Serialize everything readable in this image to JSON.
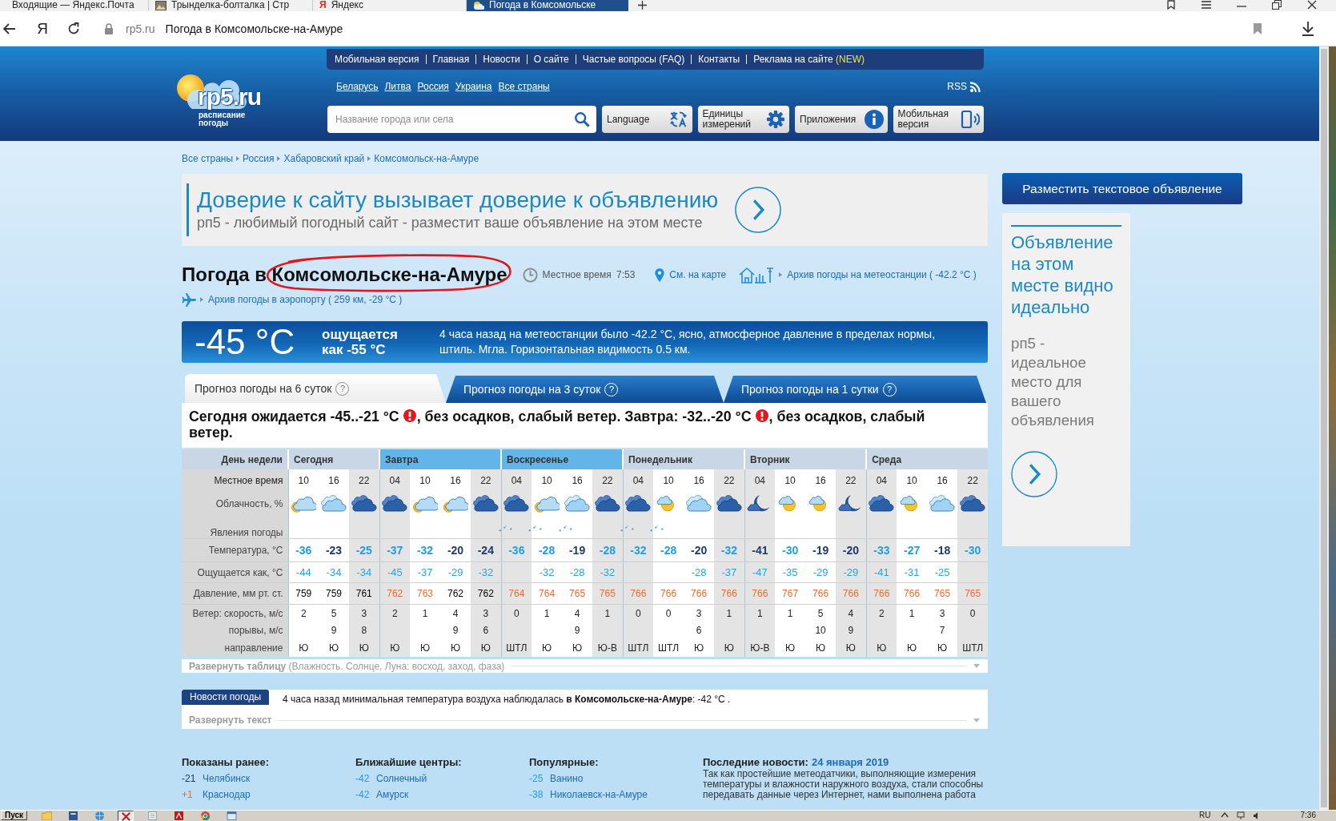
{
  "browser": {
    "tabs": [
      {
        "title": "Входящие — Яндекс.Почта",
        "selected": false
      },
      {
        "title": "Трынделка-болталка | Стр",
        "favicon": {
          "kind": "picture"
        },
        "selected": false
      },
      {
        "title": "Яндекс",
        "favicon": {
          "kind": "letter",
          "letter": "Я"
        },
        "selected": false
      },
      {
        "title": "Погода в Комсомольске",
        "favicon": {
          "kind": "weather"
        },
        "selected": true
      }
    ],
    "address": {
      "home": "Я",
      "domain": "rp5.ru",
      "title": "Погода в Комсомольске-на-Амуре"
    }
  },
  "header": {
    "logo": {
      "name": "rp5.ru",
      "tagline": "расписание погоды"
    },
    "nav": [
      {
        "label": "Мобильная версия"
      },
      {
        "label": "Главная"
      },
      {
        "label": "Новости"
      },
      {
        "label": "О сайте"
      },
      {
        "label": "Частые вопросы (FAQ)"
      },
      {
        "label": "Контакты"
      },
      {
        "label": "Реклама на сайте",
        "badge": "(NEW)"
      }
    ],
    "countries": [
      "Беларусь",
      "Литва",
      "Россия",
      "Украина",
      "Все страны"
    ],
    "rss": "RSS",
    "search": {
      "placeholder": "Название города или села"
    },
    "buttons": [
      {
        "kind": "language",
        "label": "Language"
      },
      {
        "kind": "units",
        "label": "Единицы измерений"
      },
      {
        "kind": "apps",
        "label": "Приложения"
      },
      {
        "kind": "mobile",
        "label": "Мобильная версия"
      }
    ]
  },
  "breadcrumbs": [
    "Все страны",
    "Россия",
    "Хабаровский край",
    "Комсомольск-на-Амуре"
  ],
  "ad_banner": {
    "title": "Доверие к сайту вызывает доверие к объявлению",
    "text": "рп5 - любимый погодный сайт - разместит ваше объявление на этом месте"
  },
  "location": {
    "title": "Погода в Комсомольске-на-Амуре",
    "local_time": {
      "label": "Местное время",
      "value": "7:53"
    },
    "links": [
      {
        "kind": "map",
        "label": "См. на карте"
      },
      {
        "kind": "station",
        "label": "Архив погоды на метеостанции ( -42.2 °C )"
      }
    ],
    "airport": {
      "label": "Архив погоды в аэропорту ( 259 км, -29 °C )"
    }
  },
  "current": {
    "temperature": "-45 °C",
    "feels_like": "ощущается как -55 °C",
    "description": "4 часа назад на метеостанции было -42.2 °C, ясно, атмосферное давление в пределах нормы, штиль. Мгла. Горизонтальная видимость 0.5 км."
  },
  "forecast_tabs": [
    {
      "label": "Прогноз погоды на 6 суток",
      "help": "?",
      "selected": true
    },
    {
      "label": "Прогноз погоды на 3 суток",
      "help": "?",
      "selected": false
    },
    {
      "label": "Прогноз погоды на 1 сутки",
      "help": "?",
      "selected": false
    }
  ],
  "summary": [
    {
      "text": "Сегодня ожидается -45..-21 °C",
      "warning": true
    },
    {
      "text": ", без осадков, слабый ветер. Завтра: -32..-20 °C",
      "warning": true
    },
    {
      "text": ", без осадков, слабый",
      "warning": false
    },
    {
      "text": "ветер.",
      "warning": false
    }
  ],
  "table": {
    "rows": [
      {
        "kind": "day",
        "label": "День недели"
      },
      {
        "kind": "time",
        "label": "Местное время"
      },
      {
        "kind": "cloud",
        "label": "Облачность, %"
      },
      {
        "kind": "phenomenon",
        "label": "Явления погоды"
      },
      {
        "kind": "temperature",
        "label": "Температура, °C"
      },
      {
        "kind": "feels_like",
        "label": "Ощущается как, °C"
      },
      {
        "kind": "pressure",
        "label": "Давление, мм рт. ст."
      },
      {
        "kind": "wind",
        "label": "Ветер: скорость, м/с"
      },
      {
        "kind": "gusts",
        "label": "порывы, м/с"
      },
      {
        "kind": "direction",
        "label": "направление"
      }
    ],
    "days": [
      {
        "name": "Сегодня",
        "weekend": false,
        "periods": [
          {
            "time": "10",
            "night": false,
            "cloud": {
              "kind": "cloudy_sun"
            },
            "temperature": {
              "value": "-36",
              "color": "#1e9de3"
            },
            "feels_like": "-44",
            "pressure": {
              "value": "759",
              "color": "#000000"
            },
            "wind": "2",
            "direction": "Ю"
          },
          {
            "time": "16",
            "night": false,
            "cloud": {
              "kind": "cloudy"
            },
            "temperature": {
              "value": "-23",
              "color": "#1c3b6c"
            },
            "feels_like": "-34",
            "pressure": {
              "value": "759",
              "color": "#000000"
            },
            "wind": "5",
            "gusts": "9",
            "direction": "Ю"
          },
          {
            "time": "22",
            "night": true,
            "cloud": {
              "kind": "night_cloudy"
            },
            "temperature": {
              "value": "-25",
              "color": "#1e9de3"
            },
            "feels_like": "-34",
            "pressure": {
              "value": "761",
              "color": "#000000"
            },
            "wind": "3",
            "gusts": "8",
            "direction": "Ю"
          }
        ]
      },
      {
        "name": "Завтра",
        "weekend": true,
        "periods": [
          {
            "time": "04",
            "night": true,
            "cloud": {
              "kind": "night_cloudy"
            },
            "temperature": {
              "value": "-37",
              "color": "#1e9de3"
            },
            "feels_like": "-45",
            "pressure": {
              "value": "762",
              "color": "#f0692d"
            },
            "wind": "2",
            "direction": "Ю"
          },
          {
            "time": "10",
            "night": false,
            "cloud": {
              "kind": "cloudy_sun"
            },
            "temperature": {
              "value": "-32",
              "color": "#1e9de3"
            },
            "feels_like": "-37",
            "pressure": {
              "value": "763",
              "color": "#f0692d"
            },
            "wind": "1",
            "direction": "Ю"
          },
          {
            "time": "16",
            "night": false,
            "cloud": {
              "kind": "cloudy_sun"
            },
            "temperature": {
              "value": "-20",
              "color": "#1c3b6c"
            },
            "feels_like": "-29",
            "pressure": {
              "value": "762",
              "color": "#000000"
            },
            "wind": "4",
            "gusts": "9",
            "direction": "Ю"
          },
          {
            "time": "22",
            "night": true,
            "cloud": {
              "kind": "night_cloudy"
            },
            "temperature": {
              "value": "-24",
              "color": "#1c3b6c"
            },
            "feels_like": "-32",
            "pressure": {
              "value": "762",
              "color": "#000000"
            },
            "wind": "3",
            "gusts": "6",
            "direction": "Ю"
          }
        ]
      },
      {
        "name": "Воскресенье",
        "weekend": true,
        "periods": [
          {
            "time": "04",
            "night": true,
            "cloud": {
              "kind": "night_cloudy"
            },
            "phenomenon": {
              "kind": "light_snow"
            },
            "temperature": {
              "value": "-36",
              "color": "#1e9de3"
            },
            "pressure": {
              "value": "764",
              "color": "#f0692d"
            },
            "wind": "0",
            "direction": "ШТЛ"
          },
          {
            "time": "10",
            "night": false,
            "cloud": {
              "kind": "cloudy_sun"
            },
            "phenomenon": {
              "kind": "light_snow"
            },
            "temperature": {
              "value": "-28",
              "color": "#1e9de3"
            },
            "feels_like": "-32",
            "pressure": {
              "value": "764",
              "color": "#f0692d"
            },
            "wind": "1",
            "direction": "Ю"
          },
          {
            "time": "16",
            "night": false,
            "cloud": {
              "kind": "cloudy"
            },
            "phenomenon": {
              "kind": "light_snow"
            },
            "temperature": {
              "value": "-19",
              "color": "#1c3b6c"
            },
            "feels_like": "-28",
            "pressure": {
              "value": "765",
              "color": "#f0692d"
            },
            "wind": "4",
            "gusts": "9",
            "direction": "Ю"
          },
          {
            "time": "22",
            "night": true,
            "cloud": {
              "kind": "night_cloudy"
            },
            "temperature": {
              "value": "-28",
              "color": "#1e9de3"
            },
            "feels_like": "-32",
            "pressure": {
              "value": "765",
              "color": "#f0692d"
            },
            "wind": "1",
            "direction": "Ю-В"
          }
        ]
      },
      {
        "name": "Понедельник",
        "weekend": false,
        "periods": [
          {
            "time": "04",
            "night": true,
            "cloud": {
              "kind": "night_cloudy"
            },
            "phenomenon": {
              "kind": "light_snow"
            },
            "temperature": {
              "value": "-32",
              "color": "#1e9de3"
            },
            "pressure": {
              "value": "766",
              "color": "#f0692d"
            },
            "wind": "0",
            "direction": "ШТЛ"
          },
          {
            "time": "10",
            "night": false,
            "cloud": {
              "kind": "sunny_cloud"
            },
            "phenomenon": {
              "kind": "light_snow"
            },
            "temperature": {
              "value": "-28",
              "color": "#1e9de3"
            },
            "pressure": {
              "value": "766",
              "color": "#f0692d"
            },
            "wind": "0",
            "direction": "ШТЛ"
          },
          {
            "time": "16",
            "night": false,
            "cloud": {
              "kind": "cloudy"
            },
            "temperature": {
              "value": "-20",
              "color": "#1c3b6c"
            },
            "feels_like": "-28",
            "pressure": {
              "value": "766",
              "color": "#f0692d"
            },
            "wind": "3",
            "gusts": "6",
            "direction": "Ю"
          },
          {
            "time": "22",
            "night": true,
            "cloud": {
              "kind": "night_cloudy"
            },
            "temperature": {
              "value": "-32",
              "color": "#1e9de3"
            },
            "feels_like": "-37",
            "pressure": {
              "value": "766",
              "color": "#f0692d"
            },
            "wind": "1",
            "direction": "Ю"
          }
        ]
      },
      {
        "name": "Вторник",
        "weekend": false,
        "periods": [
          {
            "time": "04",
            "night": true,
            "cloud": {
              "kind": "night_moon"
            },
            "temperature": {
              "value": "-41",
              "color": "#1c3b6c"
            },
            "feels_like": "-47",
            "pressure": {
              "value": "766",
              "color": "#f0692d"
            },
            "wind": "1",
            "direction": "Ю-В"
          },
          {
            "time": "10",
            "night": false,
            "cloud": {
              "kind": "sunny_cloud"
            },
            "temperature": {
              "value": "-30",
              "color": "#1e9de3"
            },
            "feels_like": "-35",
            "pressure": {
              "value": "767",
              "color": "#f0692d"
            },
            "wind": "1",
            "direction": "Ю"
          },
          {
            "time": "16",
            "night": false,
            "cloud": {
              "kind": "sunny_cloud"
            },
            "temperature": {
              "value": "-19",
              "color": "#1c3b6c"
            },
            "feels_like": "-29",
            "pressure": {
              "value": "766",
              "color": "#f0692d"
            },
            "wind": "5",
            "gusts": "10",
            "direction": "Ю"
          },
          {
            "time": "22",
            "night": true,
            "cloud": {
              "kind": "night_moon"
            },
            "temperature": {
              "value": "-20",
              "color": "#1c3b6c"
            },
            "feels_like": "-29",
            "pressure": {
              "value": "766",
              "color": "#f0692d"
            },
            "wind": "4",
            "gusts": "9",
            "direction": "Ю"
          }
        ]
      },
      {
        "name": "Среда",
        "weekend": false,
        "periods": [
          {
            "time": "04",
            "night": true,
            "cloud": {
              "kind": "night_cloudy"
            },
            "temperature": {
              "value": "-33",
              "color": "#1e9de3"
            },
            "feels_like": "-41",
            "pressure": {
              "value": "766",
              "color": "#f0692d"
            },
            "wind": "2",
            "direction": "Ю"
          },
          {
            "time": "10",
            "night": false,
            "cloud": {
              "kind": "sunny_cloud"
            },
            "temperature": {
              "value": "-27",
              "color": "#1e9de3"
            },
            "feels_like": "-31",
            "pressure": {
              "value": "766",
              "color": "#f0692d"
            },
            "wind": "1",
            "direction": "Ю"
          },
          {
            "time": "16",
            "night": false,
            "cloud": {
              "kind": "cloudy"
            },
            "temperature": {
              "value": "-18",
              "color": "#1c3b6c"
            },
            "feels_like": "-25",
            "pressure": {
              "value": "765",
              "color": "#f0692d"
            },
            "wind": "3",
            "gusts": "7",
            "direction": "Ю"
          },
          {
            "time": "22",
            "night": true,
            "cloud": {
              "kind": "night_cloudy"
            },
            "temperature": {
              "value": "-30",
              "color": "#1e9de3"
            },
            "pressure": {
              "value": "765",
              "color": "#f0692d"
            },
            "wind": "0",
            "direction": "ШТЛ"
          }
        ]
      }
    ]
  },
  "expand_table": {
    "label": "Развернуть таблицу",
    "hint": "(Влажность. Солнце, Луна: восход, заход, фаза)"
  },
  "news": {
    "label": "Новости погоды",
    "text": "4 часа назад минимальная температура воздуха наблюдалась **в Комсомольске-на-Амуре**: -42 °C .",
    "expand": "Развернуть текст"
  },
  "footer": {
    "lists": [
      {
        "title": "Показаны ранее:",
        "items": [
          {
            "temperature": "-21",
            "color": "#1c3b6c",
            "name": "Челябинск"
          },
          {
            "temperature": "+1",
            "color": "#f0692d",
            "name": "Краснодар"
          }
        ]
      },
      {
        "title": "Ближайшие центры:",
        "items": [
          {
            "temperature": "-42",
            "color": "#1e9de3",
            "name": "Солнечный"
          },
          {
            "temperature": "-42",
            "color": "#1e9de3",
            "name": "Амурск"
          }
        ]
      },
      {
        "title": "Популярные:",
        "items": [
          {
            "temperature": "-25",
            "color": "#1e9de3",
            "name": "Ванино"
          },
          {
            "temperature": "-38",
            "color": "#1e9de3",
            "name": "Николаевск-на-Амуре"
          }
        ]
      }
    ],
    "latest_news": {
      "title": "Последние новости:",
      "date": "24 января 2019",
      "text": "Так как простейшие метеодатчики, выполняющие измерения температуры и влажности наружного воздуха, стали способны передавать данные через Интернет, нами выполнена работа"
    }
  },
  "sidebar": {
    "button": "Разместить текстовое объявление",
    "ad": {
      "title": "Объявление на этом месте видно идеально",
      "text": "рп5 - идеальное место для вашего объявления"
    }
  },
  "taskbar": {
    "start": "Пуск",
    "apps": [
      {
        "kind": "folder",
        "selected": false
      },
      {
        "kind": "word",
        "selected": false
      },
      {
        "kind": "globe",
        "selected": false
      },
      {
        "kind": "cross",
        "selected": true
      },
      {
        "kind": "document",
        "selected": false
      },
      {
        "kind": "acrobat",
        "selected": false
      },
      {
        "kind": "chrome",
        "selected": false
      },
      {
        "kind": "window",
        "selected": false
      }
    ],
    "language": "RU",
    "time": "7:36"
  }
}
